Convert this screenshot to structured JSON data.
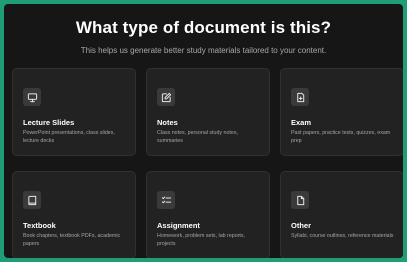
{
  "page": {
    "title": "What type of document is this?",
    "subtitle": "This helps us generate better study materials tailored to your content."
  },
  "cards": [
    {
      "label": "Lecture Slides",
      "description": "PowerPoint presentations, class slides, lecture decks",
      "icon": "presentation-icon"
    },
    {
      "label": "Notes",
      "description": "Class notes, personal study notes, summaries",
      "icon": "edit-note-icon"
    },
    {
      "label": "Exam",
      "description": "Past papers, practice tests, quizzes, exam prep",
      "icon": "exam-document-icon"
    },
    {
      "label": "Textbook",
      "description": "Book chapters, textbook PDFs, academic papers",
      "icon": "book-icon"
    },
    {
      "label": "Assignment",
      "description": "Homework, problem sets, lab reports, projects",
      "icon": "checklist-icon"
    },
    {
      "label": "Other",
      "description": "Syllabi, course outlines, reference materials",
      "icon": "file-icon"
    }
  ],
  "colors": {
    "accent_border": "#1f9d77",
    "background": "#161616",
    "card": "#222222",
    "icon_bg": "#3a3a3a"
  }
}
